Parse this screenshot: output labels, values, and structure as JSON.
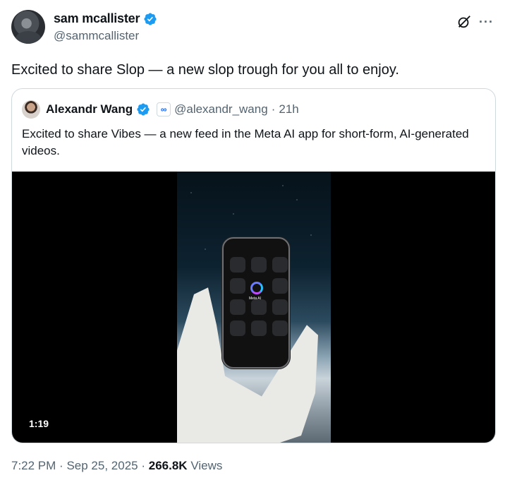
{
  "author": {
    "name": "sam mcallister",
    "handle": "@sammcallister",
    "verified": true
  },
  "header_icons": [
    "grok-icon",
    "more-icon"
  ],
  "tweet": {
    "text": "Excited to share Slop — a new slop trough for you all to enjoy."
  },
  "quoted_tweet": {
    "name": "Alexandr Wang",
    "verified": true,
    "affiliate_badge": "∞",
    "handle": "@alexandr_wang",
    "separator": "·",
    "time": "21h",
    "text": "Excited to share Vibes — a new feed in the Meta AI app for short-form, AI-generated videos.",
    "media": {
      "duration": "1:19",
      "phone_app_label": "Meta AI"
    }
  },
  "footer": {
    "time": "7:22 PM",
    "separator": "·",
    "date": "Sep 25, 2025",
    "views_count": "266.8K",
    "views_label": "Views"
  },
  "colors": {
    "verified_blue": "#1d9bf0",
    "secondary_text": "#536471",
    "border": "#cfd9de"
  }
}
